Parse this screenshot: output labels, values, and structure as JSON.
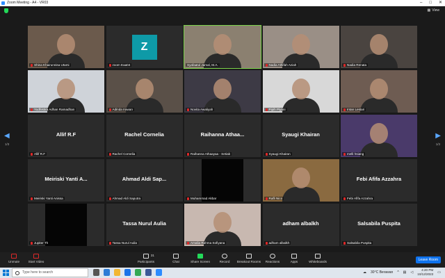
{
  "window": {
    "title": "Zoom Meeting - A4 - VR03",
    "controls": [
      "–",
      "□",
      "✕"
    ]
  },
  "topbar": {
    "view_label": "View"
  },
  "grid": {
    "page_left": "1/3",
    "page_right": "1/3",
    "tiles": [
      {
        "label": "Shina Khairunnisa Utami",
        "type": "video",
        "muted": true
      },
      {
        "label": "zoom Eaa04",
        "type": "avatar",
        "avatar": "Z",
        "muted": true
      },
      {
        "label": "Syafaatul Jamal, M.A.",
        "type": "video",
        "active": true,
        "muted": false
      },
      {
        "label": "Nadia Athifah Aziah",
        "type": "video",
        "muted": true
      },
      {
        "label": "Nadia Renata",
        "type": "video",
        "muted": true
      },
      {
        "label": "Yudhistira Adhan Ramadhan",
        "type": "video",
        "muted": true
      },
      {
        "label": "Adinda Irawan",
        "type": "video",
        "muted": true
      },
      {
        "label": "Novita Awaliyah",
        "type": "video",
        "muted": true
      },
      {
        "label": "Pipih Piyani",
        "type": "video",
        "muted": true
      },
      {
        "label": "Intan Lestari",
        "type": "video",
        "muted": true
      },
      {
        "name": "Allif R.F",
        "label": "Allif R.F",
        "type": "name",
        "muted": true
      },
      {
        "name": "Rachel Cornelia",
        "label": "Rachel Cornelia",
        "type": "name",
        "muted": true
      },
      {
        "name": "Raihanna Athaa...",
        "label": "Raihanna Athaayaa - Setiab",
        "type": "name",
        "muted": true
      },
      {
        "name": "Syaugi Khairan",
        "label": "Syaugi Khairan",
        "type": "name",
        "muted": true
      },
      {
        "label": "melli hsiang",
        "type": "video",
        "muted": true
      },
      {
        "name": "Meiriski Yanti A...",
        "label": "Meiriski Yanti Anissa",
        "type": "name",
        "muted": true
      },
      {
        "name": "Ahmad Aldi Sap...",
        "label": "Ahmad Aldi Saputra",
        "type": "name",
        "muted": true
      },
      {
        "label": "Muhammad Akbar",
        "type": "dark",
        "muted": true
      },
      {
        "label": "Rafli Nico",
        "type": "video",
        "muted": true
      },
      {
        "name": "Febi Afifa Azzahra",
        "label": "Febi Afifa Azzahra",
        "type": "name",
        "muted": true
      },
      {
        "label": "Jupiter Th",
        "type": "dark",
        "muted": true
      },
      {
        "name": "Tassa Nurul Aulia",
        "label": "Tassa Nurul Aulia",
        "type": "name",
        "muted": true
      },
      {
        "label": "Amalia Rahma Sofiyana",
        "type": "video",
        "muted": true
      },
      {
        "name": "adham albalkh",
        "label": "adham albalkh",
        "type": "name",
        "muted": true
      },
      {
        "name": "Salsabila Puspita",
        "label": "Salsabila Puspita",
        "type": "name",
        "muted": true
      }
    ]
  },
  "toolbar": {
    "unmute": "Unmute",
    "start_video": "Start Video",
    "participants": "Participants",
    "participants_count": "31",
    "chat": "Chat",
    "share_screen": "Share Screen",
    "record": "Record",
    "breakout_rooms": "Breakout Rooms",
    "reactions": "Reactions",
    "apps": "Apps",
    "whiteboards": "Whiteboards",
    "leave": "Leave Room"
  },
  "taskbar": {
    "search_placeholder": "Type here to search",
    "weather": "30°C  Berawan",
    "time": "4:20 PM",
    "date": "10/12/2022"
  },
  "colors": {
    "accent": "#0e72ed",
    "active_speaker": "#7bd44a",
    "muted": "#e02828"
  }
}
